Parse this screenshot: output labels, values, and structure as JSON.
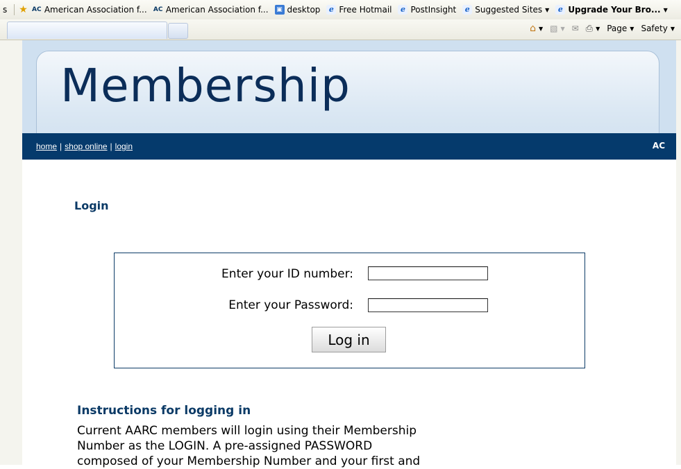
{
  "favorites_bar": {
    "cut_label": "s",
    "items": [
      {
        "label": "American Association f...",
        "icon": "aarc-logo-icon"
      },
      {
        "label": "American Association f...",
        "icon": "aarc-logo-icon"
      },
      {
        "label": "desktop",
        "icon": "desktop-icon"
      },
      {
        "label": "Free Hotmail",
        "icon": "ie-page-icon"
      },
      {
        "label": "PostInsight",
        "icon": "ie-page-icon"
      },
      {
        "label": "Suggested Sites",
        "icon": "ie-page-icon"
      },
      {
        "label": "Upgrade Your Bro...",
        "icon": "ie-page-icon"
      }
    ]
  },
  "command_bar": {
    "page_label": "Page",
    "safety_label": "Safety"
  },
  "site": {
    "title": "Membership",
    "nav": [
      "home",
      "shop online",
      "login"
    ],
    "logo_text": "AC"
  },
  "login": {
    "heading": "Login",
    "id_label": "Enter your ID number:",
    "id_value": "",
    "password_label": "Enter your Password:",
    "password_value": "",
    "button_label": "Log in"
  },
  "instructions": {
    "heading": "Instructions for logging in",
    "text": "Current AARC members will login using their Membership Number as the LOGIN. A pre-assigned PASSWORD composed of your Membership Number and your first and"
  },
  "colors": {
    "navy": "#053a6c",
    "title": "#0b2d59",
    "header_bg": "#dae7f3"
  }
}
